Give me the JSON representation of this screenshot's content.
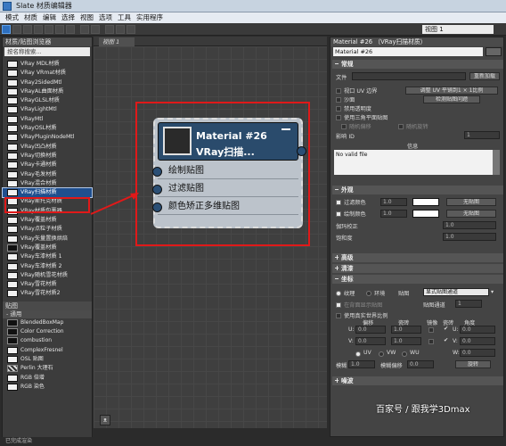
{
  "window": {
    "title": "Slate 材质编辑器"
  },
  "menu": [
    "模式",
    "材质",
    "编辑",
    "选择",
    "视图",
    "选项",
    "工具",
    "实用程序"
  ],
  "toolbar": {
    "view_select": "视图 1"
  },
  "browser": {
    "title": "材质/贴图浏览器",
    "search_placeholder": "按名称搜索...",
    "materials": [
      "VRay MDL材质",
      "VRay VRmat材质",
      "VRay2SidedMtl",
      "VRayAL曲面材质",
      "VRayGLSL材质",
      "VRayLightMtl",
      "VRayMtl",
      "VRayOSL材质",
      "VRayPluginNodeMtl",
      "VRay凹凸材质",
      "VRay切换材质",
      "VRay卡通材质",
      "VRay毛发材质",
      "VRay混合材质",
      "VRay扫描材质",
      "VRay斯托克材质",
      "VRay材质包裹器",
      "VRay覆盖材质",
      "VRay点粒子材质",
      "VRay矢量置换烘焙",
      "VRay覆盖材质",
      "VRay车漆材质 1",
      "VRay车漆材质 2",
      "VRay随机雪花材质",
      "VRay雪花材质",
      "VRay雪花材质2"
    ],
    "maps_header": "贴图",
    "maps_group": "- 通用",
    "maps": [
      "BlendedBoxMap",
      "Color Correction",
      "combustion",
      "ComplexFresnel",
      "OSL 贴图",
      "Perlin 大理石",
      "RGB 倍增",
      "RGB 染色"
    ]
  },
  "view": {
    "tab": "视图 1"
  },
  "node": {
    "title_line1": "Material #26",
    "title_line2": "VRay扫描...",
    "slots": [
      "绘制贴图",
      "过滤贴图",
      "颜色矫正多维贴图"
    ]
  },
  "props": {
    "title": "Material #26 （VRay扫描材质）",
    "name": "Material #26",
    "sec_common": "常规",
    "file_label": "文件",
    "load_btn": "重新加载",
    "uv_chk": "视口 UV 边界",
    "uv_btn": "调整 UV 平铺到1 × 1比例",
    "triplanar": "沙面",
    "deep_btn": "检测贴图问题",
    "transparency": "禁用透明度",
    "triplanar_map": "使用三角平面贴图",
    "random_offset": "随机偏移",
    "random_rotate": "随机旋转",
    "influence_label": "影响 ID",
    "influence_value": "1",
    "info_label": "信息",
    "info_text": "No valid file",
    "sec_appearance": "外观",
    "filter_color": "过滤颜色",
    "filter_value": "1.0",
    "filter_btn": "无贴图",
    "draw_color": "绘制颜色",
    "draw_value": "1.0",
    "draw_btn": "无贴图",
    "gamma_label": "伽玛校正",
    "gamma_value": "1.0",
    "saturation_label": "饱和度",
    "saturation_value": "1.0",
    "sec_advanced": "高级",
    "sec_clearcoat": "清漆",
    "sec_coords": "坐标",
    "texture_radio": "纹理",
    "env_radio": "环境",
    "map_label": "贴图",
    "map_value": "显式贴图通道",
    "show_back": "在背面显示贴图",
    "map_channel_label": "贴图通道",
    "map_channel_value": "1",
    "real_world": "使用真实世界比例",
    "offset_label": "偏移",
    "tiling_label": "瓷砖",
    "mirror_label": "镜像",
    "tile_label": "瓷砖",
    "angle_label": "角度",
    "u_label": "U:",
    "v_label": "V:",
    "w_label": "W:",
    "u_offset": "0.0",
    "v_offset": "0.0",
    "u_tiling": "1.0",
    "v_tiling": "1.0",
    "u_angle": "0.0",
    "v_angle": "0.0",
    "w_angle": "0.0",
    "uv_radio": "UV",
    "vw_radio": "VW",
    "wu_radio": "WU",
    "blur_label": "模糊",
    "blur_value": "1.0",
    "blur_offset_label": "模糊偏移",
    "blur_offset_value": "0.0",
    "rotate_btn": "旋转",
    "sec_noise": "噪波"
  },
  "status": "已完成渲染",
  "watermark": "百家号 / 跟我学3Dmax"
}
